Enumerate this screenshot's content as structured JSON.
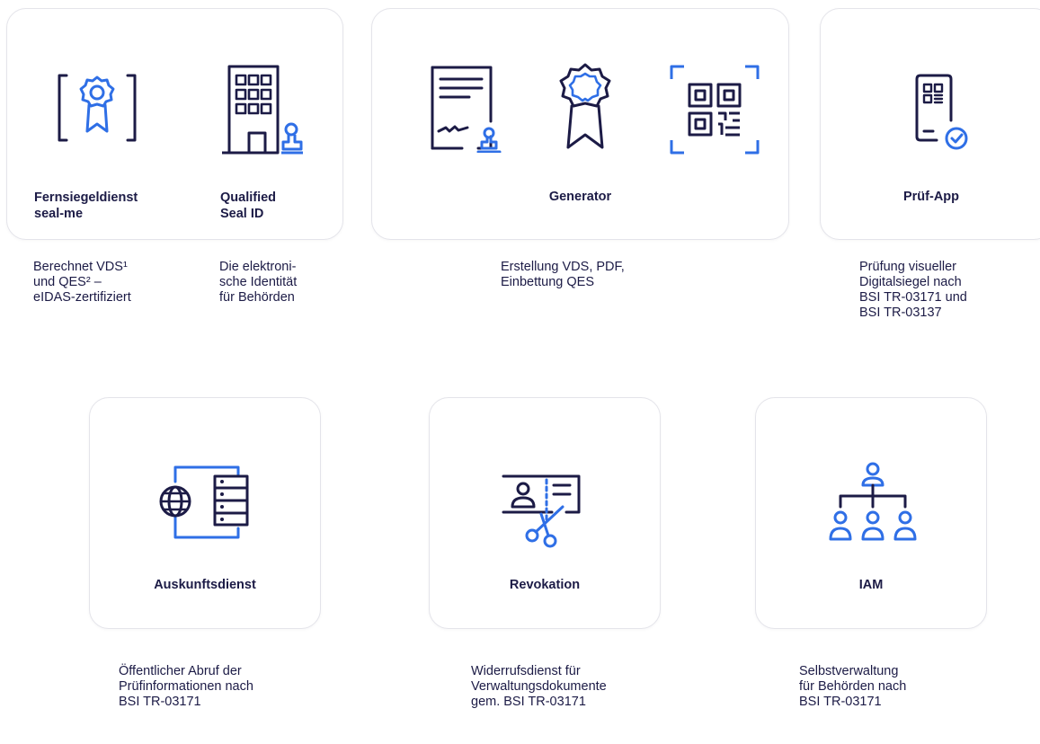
{
  "services": [
    {
      "title": [
        "Fernsiegeldienst",
        "seal-me"
      ],
      "description": [
        "Berechnet VDS¹",
        "und QES² –",
        "eIDAS-zertifiziert"
      ]
    },
    {
      "title": [
        "Qualified",
        "Seal ID"
      ],
      "description": [
        "Die elektroni-",
        "sche Identität",
        "für Behörden"
      ]
    },
    {
      "title": [
        "Generator"
      ],
      "description": [
        "Erstellung VDS, PDF,",
        "Einbettung QES"
      ]
    },
    {
      "title": [
        "Prüf-App"
      ],
      "description": [
        "Prüfung visueller",
        "Digitalsiegel nach",
        "BSI TR-03171 und",
        "BSI TR-03137"
      ]
    },
    {
      "title": [
        "Auskunftsdienst"
      ],
      "description": [
        "Öffentlicher Abruf der",
        "Prüfinformationen nach",
        "BSI TR-03171"
      ]
    },
    {
      "title": [
        "Revokation"
      ],
      "description": [
        "Widerrufsdienst für",
        "Verwaltungsdokumente",
        "gem. BSI TR-03171"
      ]
    },
    {
      "title": [
        "IAM"
      ],
      "description": [
        "Selbstverwaltung",
        "für Behörden nach",
        "BSI TR-03171"
      ]
    }
  ],
  "colors": {
    "navy": "#1c1b46",
    "blue": "#2f6fe6",
    "border": "#e4e4ea"
  },
  "icons": [
    "certificate-seal-icon",
    "building-stamp-icon",
    "document-signature-icon",
    "rosette-icon",
    "qr-code-scan-icon",
    "phone-qr-check-icon",
    "globe-server-icon",
    "id-card-scissors-icon",
    "org-hierarchy-icon"
  ]
}
